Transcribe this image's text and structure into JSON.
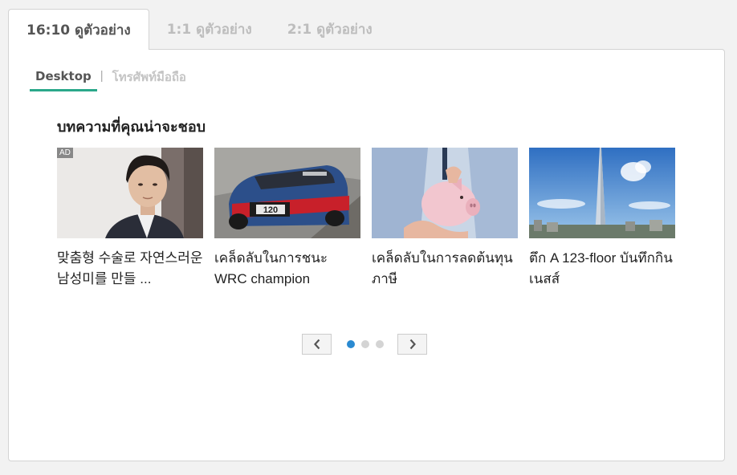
{
  "tabs": [
    {
      "label": "16:10 ดูตัวอย่าง",
      "active": true
    },
    {
      "label": "1:1 ดูตัวอย่าง",
      "active": false
    },
    {
      "label": "2:1 ดูตัวอย่าง",
      "active": false
    }
  ],
  "subtabs": {
    "desktop": "Desktop",
    "separator": "|",
    "mobile": "โทรศัพท์มือถือ"
  },
  "section": {
    "heading": "บทความที่คุณน่าจะชอบ"
  },
  "cards": [
    {
      "ad_badge": "AD",
      "title": "맞춤형 수술로 자연스러운 남성미를 만들 ...",
      "image": "man-portrait"
    },
    {
      "title": "เคล็ดลับในการชนะ WRC champion",
      "image": "rally-car"
    },
    {
      "title": "เคล็ดลับในการลดต้นทุนภาษี",
      "image": "piggy-bank"
    },
    {
      "title": "ตึก A 123-floor บันทึกกินเนสส์",
      "image": "skyscraper"
    }
  ],
  "pagination": {
    "prev_icon": "chevron-left-icon",
    "next_icon": "chevron-right-icon",
    "pages": 3,
    "current": 1
  },
  "colors": {
    "accent": "#2aa88a",
    "active_dot": "#2a8ad1"
  }
}
